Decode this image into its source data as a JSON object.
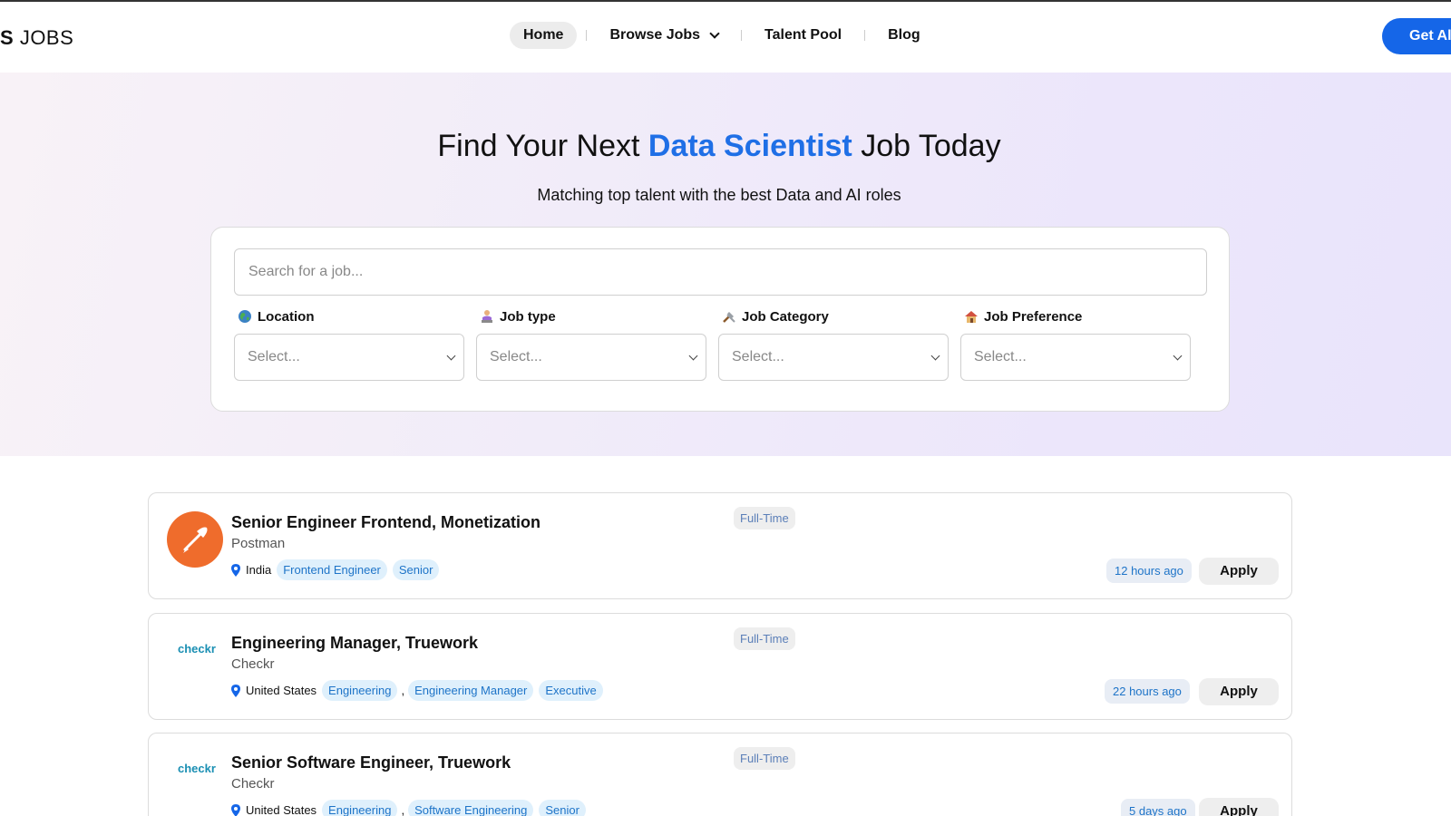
{
  "header": {
    "logo_bold": "S",
    "logo_light": "JOBS",
    "nav": [
      {
        "label": "Home",
        "active": true
      },
      {
        "label": "Browse Jobs",
        "dropdown": true
      },
      {
        "label": "Talent Pool"
      },
      {
        "label": "Blog"
      }
    ],
    "cta_label": "Get Ale"
  },
  "hero": {
    "title_prefix": "Find Your Next",
    "title_accent": "Data Scientist",
    "title_suffix": "Job Today",
    "subtitle": "Matching top talent with the best Data and AI roles",
    "search_placeholder": "Search for a job...",
    "filters": [
      {
        "label": "Location",
        "icon": "globe-icon",
        "value": "Select..."
      },
      {
        "label": "Job type",
        "icon": "person-laptop-icon",
        "value": "Select..."
      },
      {
        "label": "Job Category",
        "icon": "tools-icon",
        "value": "Select..."
      },
      {
        "label": "Job Preference",
        "icon": "house-icon",
        "value": "Select..."
      }
    ]
  },
  "jobs": [
    {
      "title": "Senior Engineer Frontend, Monetization",
      "company": "Postman",
      "logo": "postman-logo",
      "location": "India",
      "tags": [
        "Frontend Engineer",
        "Senior"
      ],
      "employment": "Full-Time",
      "posted": "12 hours ago",
      "apply": "Apply"
    },
    {
      "title": "Engineering Manager, Truework",
      "company": "Checkr",
      "logo_text": "checkr",
      "location": "United States",
      "tags": [
        "Engineering",
        "Engineering Manager",
        "Executive"
      ],
      "employment": "Full-Time",
      "posted": "22 hours ago",
      "apply": "Apply"
    },
    {
      "title": "Senior Software Engineer, Truework",
      "company": "Checkr",
      "logo_text": "checkr",
      "location": "United States",
      "tags": [
        "Engineering",
        "Software Engineering",
        "Senior"
      ],
      "employment": "Full-Time",
      "posted": "5 days ago",
      "apply": "Apply"
    }
  ],
  "colors": {
    "accent": "#1f6fe6",
    "cta": "#1566e8",
    "tag_bg": "#dff0fc",
    "tag_text": "#1e74c8",
    "postman": "#ef6c2c"
  }
}
